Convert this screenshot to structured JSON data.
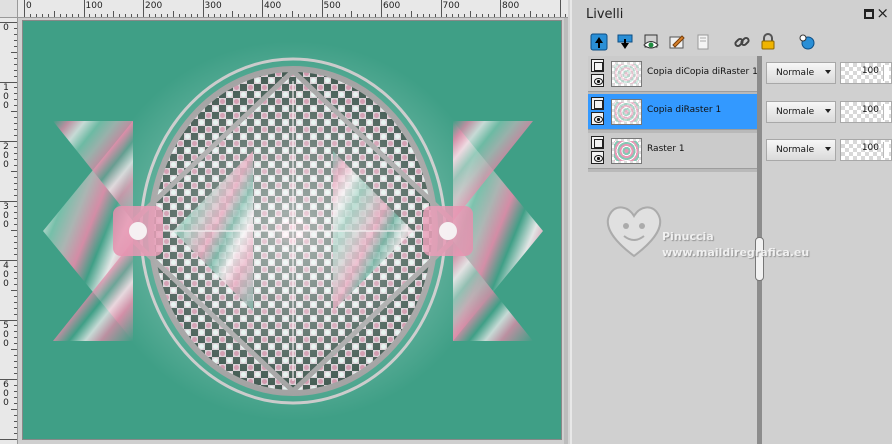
{
  "ruler": {
    "top_labels": [
      "0",
      "100",
      "200",
      "300",
      "400",
      "500",
      "600",
      "700",
      "800"
    ],
    "left_labels": [
      "0",
      "1\n0\n0",
      "2\n0\n0",
      "3\n0\n0",
      "4\n0\n0",
      "5\n0\n0",
      "6\n0\n0"
    ]
  },
  "canvas": {
    "image_name": "kaleidoscope-artwork",
    "colors": {
      "pink": "#e48aa9",
      "green": "#3f9f86",
      "teal_dark": "#1e6e5b",
      "white": "#f4eef0",
      "grey": "#9a9a9a"
    }
  },
  "layers_panel": {
    "title": "Livelli",
    "close_label": "×",
    "toolbar": [
      {
        "icon": "new-layer-icon"
      },
      {
        "icon": "merge-down-icon"
      },
      {
        "icon": "visibility-toggle-icon"
      },
      {
        "icon": "edit-layer-icon"
      },
      {
        "icon": "delete-layer-icon"
      },
      {
        "icon": "link-icon"
      },
      {
        "icon": "lock-icon"
      },
      {
        "icon": "mask-icon"
      }
    ],
    "layers": [
      {
        "name": "Copia diCopia diRaster 1",
        "blend_mode": "Normale",
        "opacity": "100",
        "selected": false
      },
      {
        "name": "Copia diRaster 1",
        "blend_mode": "Normale",
        "opacity": "100",
        "selected": true
      },
      {
        "name": "Raster 1",
        "blend_mode": "Normale",
        "opacity": "100",
        "selected": false
      }
    ],
    "watermark": {
      "name": "Pinuccia",
      "site": "www.maildiregrafica.eu"
    }
  },
  "accent_color": "#3399ff"
}
